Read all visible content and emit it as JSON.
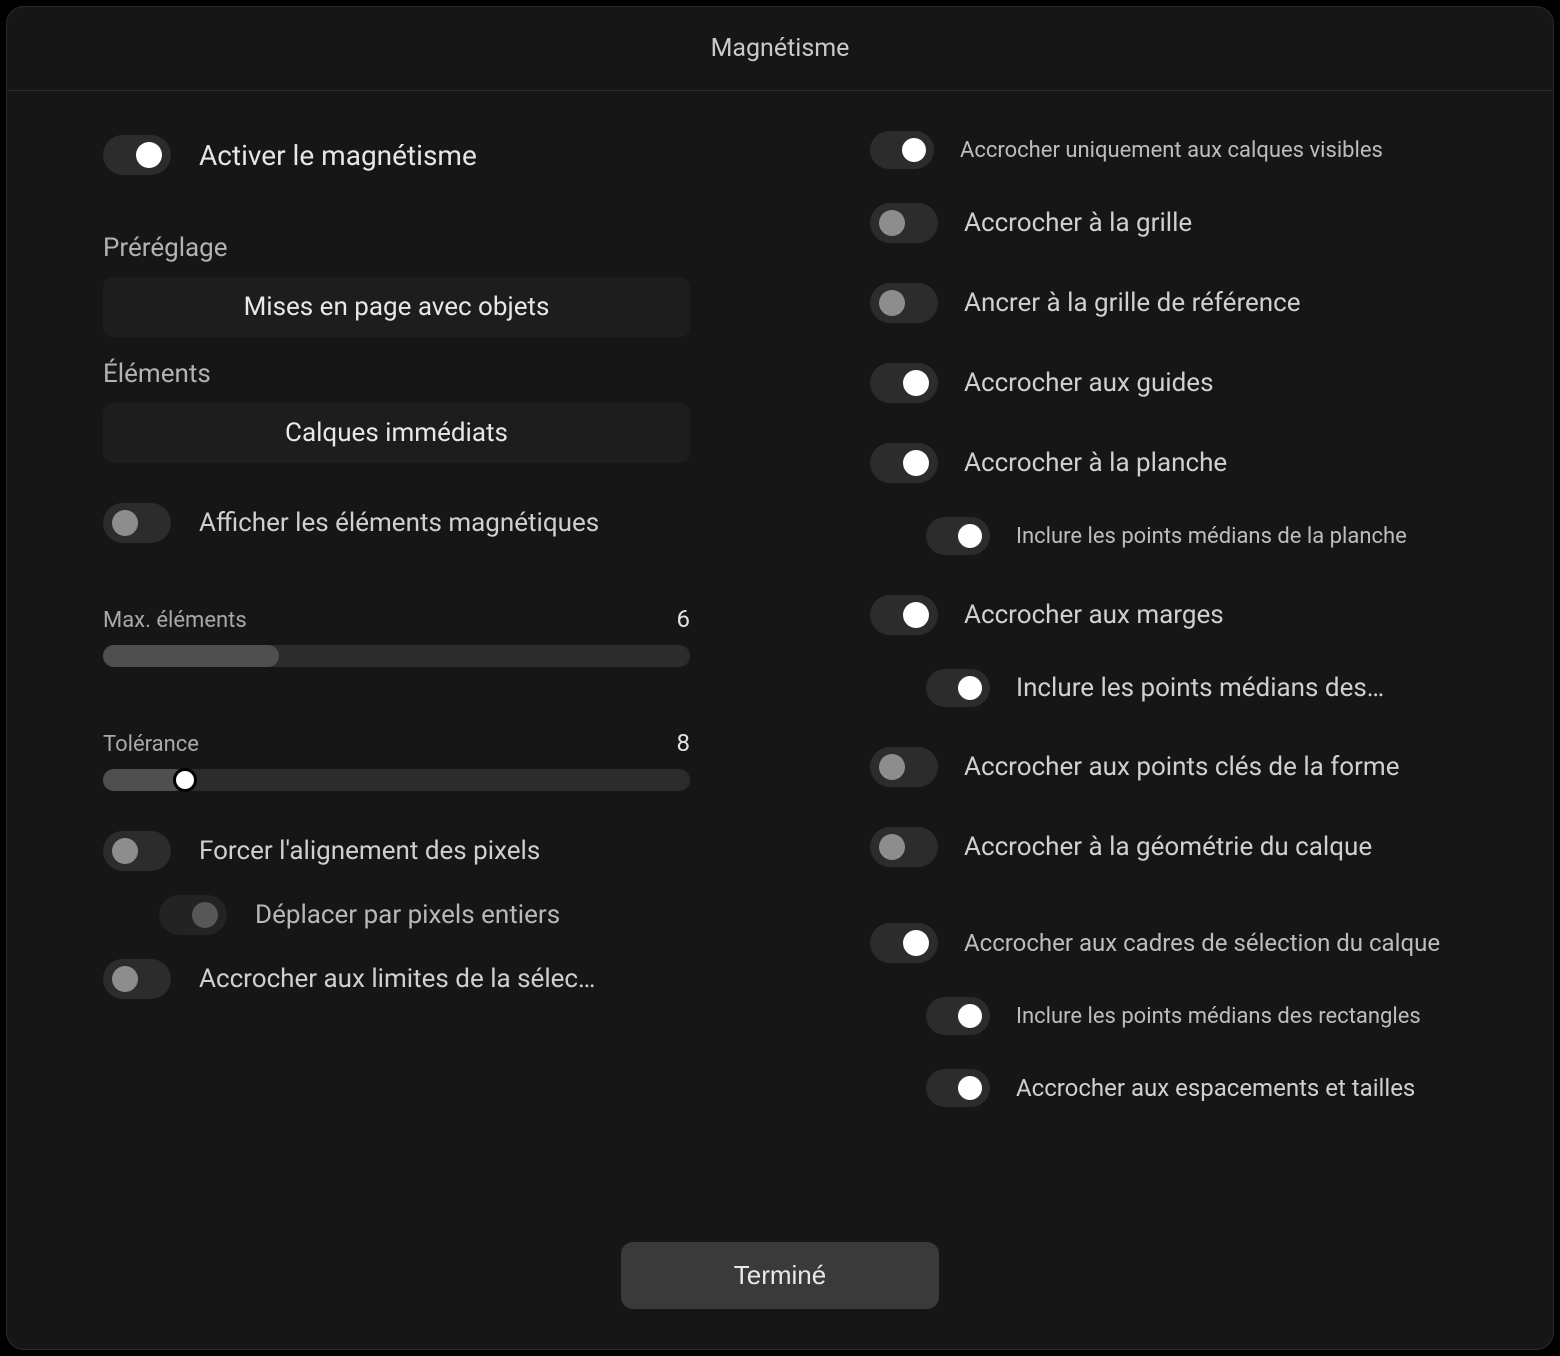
{
  "title": "Magnétisme",
  "left": {
    "enable": {
      "label": "Activer le magnétisme",
      "on": true
    },
    "preset": {
      "label": "Préréglage",
      "value": "Mises en page avec objets"
    },
    "elements": {
      "label": "Éléments",
      "value": "Calques immédiats"
    },
    "show_elements": {
      "label": "Afficher les éléments magnétiques",
      "on": false
    },
    "max_elements": {
      "label": "Max. éléments",
      "value": "6",
      "fill_pct": 30
    },
    "tolerance": {
      "label": "Tolérance",
      "value": "8",
      "fill_pct": 14,
      "thumb_pct": 14
    },
    "force_pixel": {
      "label": "Forcer l'alignement des pixels",
      "on": false
    },
    "move_whole_pixels": {
      "label": "Déplacer par pixels entiers",
      "on": false
    },
    "snap_selection_bounds": {
      "label": "Accrocher aux limites de la sélec…",
      "on": false
    }
  },
  "right": {
    "visible_layers": {
      "label": "Accrocher uniquement aux calques visibles",
      "on": true
    },
    "snap_grid": {
      "label": "Accrocher à la grille",
      "on": false
    },
    "anchor_ref_grid": {
      "label": "Ancrer à la grille de référence",
      "on": false
    },
    "snap_guides": {
      "label": "Accrocher aux guides",
      "on": true
    },
    "snap_artboard": {
      "label": "Accrocher à la planche",
      "on": true
    },
    "include_artboard_mid": {
      "label": "Inclure les points médians de la planche",
      "on": true
    },
    "snap_margins": {
      "label": "Accrocher aux marges",
      "on": true
    },
    "include_margin_mid": {
      "label": "Inclure les points médians des…",
      "on": true
    },
    "snap_keypoints": {
      "label": "Accrocher aux points clés de la forme",
      "on": false
    },
    "snap_layer_geom": {
      "label": "Accrocher à la géométrie du calque",
      "on": false
    },
    "snap_bbox": {
      "label": "Accrocher aux cadres de sélection du calque",
      "on": true
    },
    "include_rect_mid": {
      "label": "Inclure les points médians des rectangles",
      "on": true
    },
    "snap_spacing": {
      "label": "Accrocher aux espacements et tailles",
      "on": true
    }
  },
  "done": "Terminé"
}
